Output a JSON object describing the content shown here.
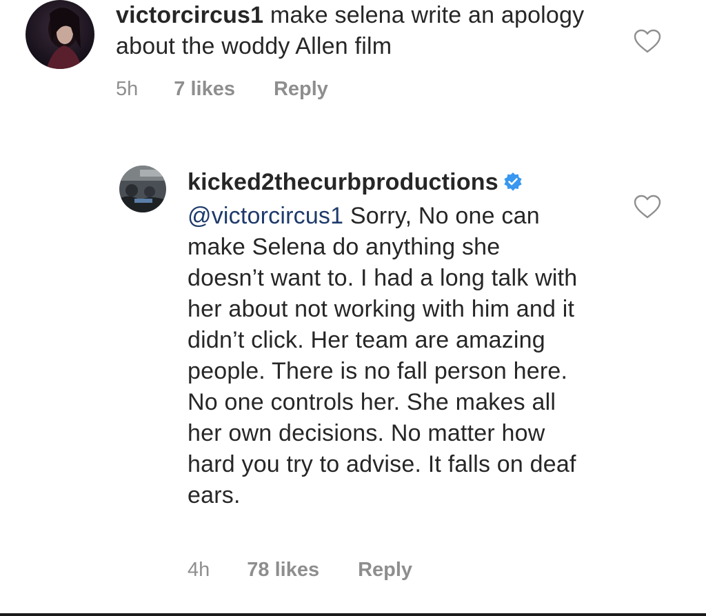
{
  "comments": [
    {
      "username": "victorcircus1",
      "text": " make selena write an apology about the woddy Allen film",
      "time": "5h",
      "likes": "7 likes",
      "reply": "Reply",
      "avatar_icon": "profile-photo-dark",
      "like_icon": "heart-outline-icon"
    },
    {
      "username": "kicked2thecurbproductions",
      "verified_icon": "verified-badge-icon",
      "mention": "@victorcircus1",
      "text": " Sorry, No one can make Selena do anything she doesn’t want to. I had a long talk with her about not working with him and it didn’t click. Her team are amazing people. There is no fall person here. No one controls her. She makes all her own decisions. No matter how hard you try to advise. It falls on deaf ears.",
      "time": "4h",
      "likes": "78 likes",
      "reply": "Reply",
      "avatar_icon": "profile-photo-group",
      "like_icon": "heart-outline-icon"
    }
  ],
  "colors": {
    "text": "#262626",
    "meta": "#8e8e8e",
    "mention": "#1e3a6b",
    "verified": "#3897f0"
  }
}
